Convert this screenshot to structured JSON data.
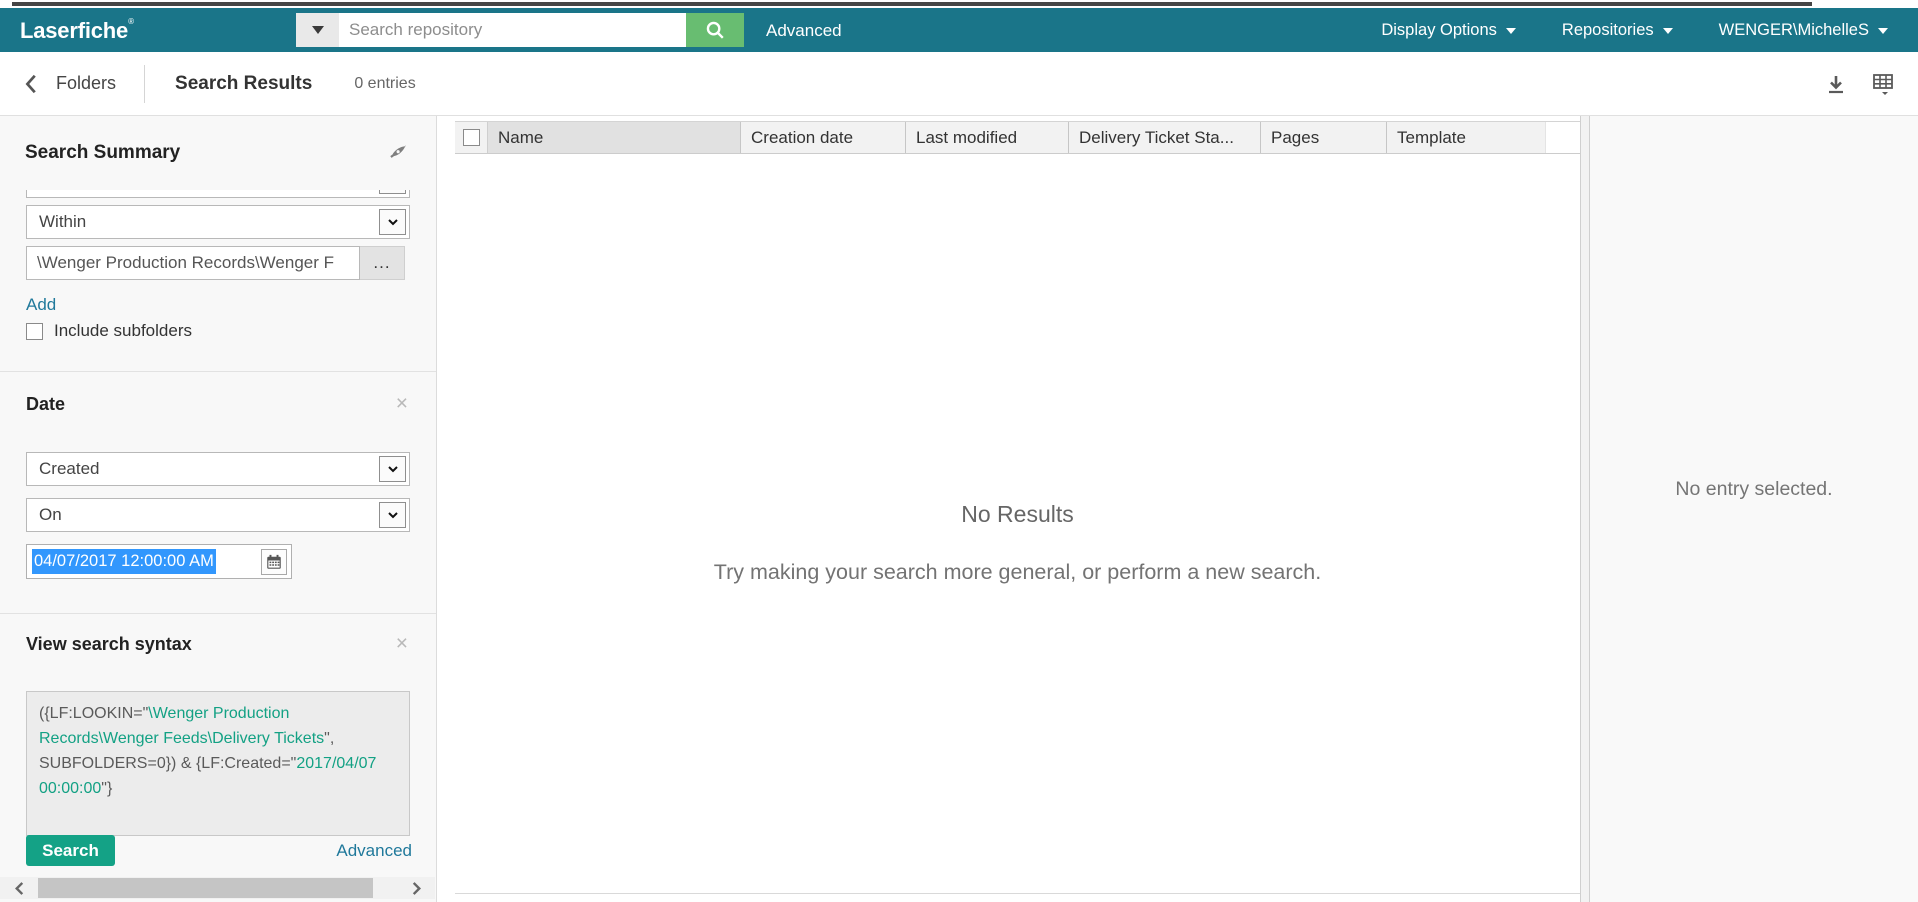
{
  "appbar": {
    "logo": "Laserfiche",
    "logo_mark": "®",
    "search_placeholder": "Search repository",
    "advanced_label": "Advanced",
    "menus": [
      {
        "label": "Display Options"
      },
      {
        "label": "Repositories"
      },
      {
        "label": "WENGER\\MichelleS"
      }
    ]
  },
  "toolbar": {
    "back_label": "Folders",
    "title": "Search Results",
    "entries_count": "0 entries"
  },
  "sidebar": {
    "title": "Search Summary",
    "within_value": "Within",
    "path_value": "\\Wenger Production Records\\Wenger F",
    "browse_label": "...",
    "add_label": "Add",
    "include_subfolders_label": "Include subfolders",
    "date_section": {
      "title": "Date",
      "field_value": "Created",
      "operator_value": "On",
      "date_value": "04/07/2017 12:00:00 AM"
    },
    "syntax_section": {
      "title": "View search syntax",
      "parts": [
        {
          "text": "({LF:LOOKIN=\""
        },
        {
          "text": "\\Wenger Production Records\\Wenger Feeds\\Delivery Tickets"
        },
        {
          "text": "\", SUBFOLDERS=0}) & {LF:Created=\""
        },
        {
          "text": "2017/04/07 00:00:00"
        },
        {
          "text": "\"}"
        }
      ]
    },
    "search_button_label": "Search",
    "advanced_label": "Advanced"
  },
  "table": {
    "columns": [
      "Name",
      "Creation date",
      "Last modified",
      "Delivery Ticket Sta...",
      "Pages",
      "Template"
    ]
  },
  "empty_state": {
    "title": "No Results",
    "message": "Try making your search more general, or perform a new search."
  },
  "right_panel": {
    "message": "No entry selected."
  },
  "colors": {
    "appbar_teal": "#1a7589",
    "search_button_green": "#68bd71",
    "action_teal": "#14a286",
    "link_teal": "#20799b",
    "selection_blue": "#3297fd",
    "syntax_teal": "#13a184"
  }
}
